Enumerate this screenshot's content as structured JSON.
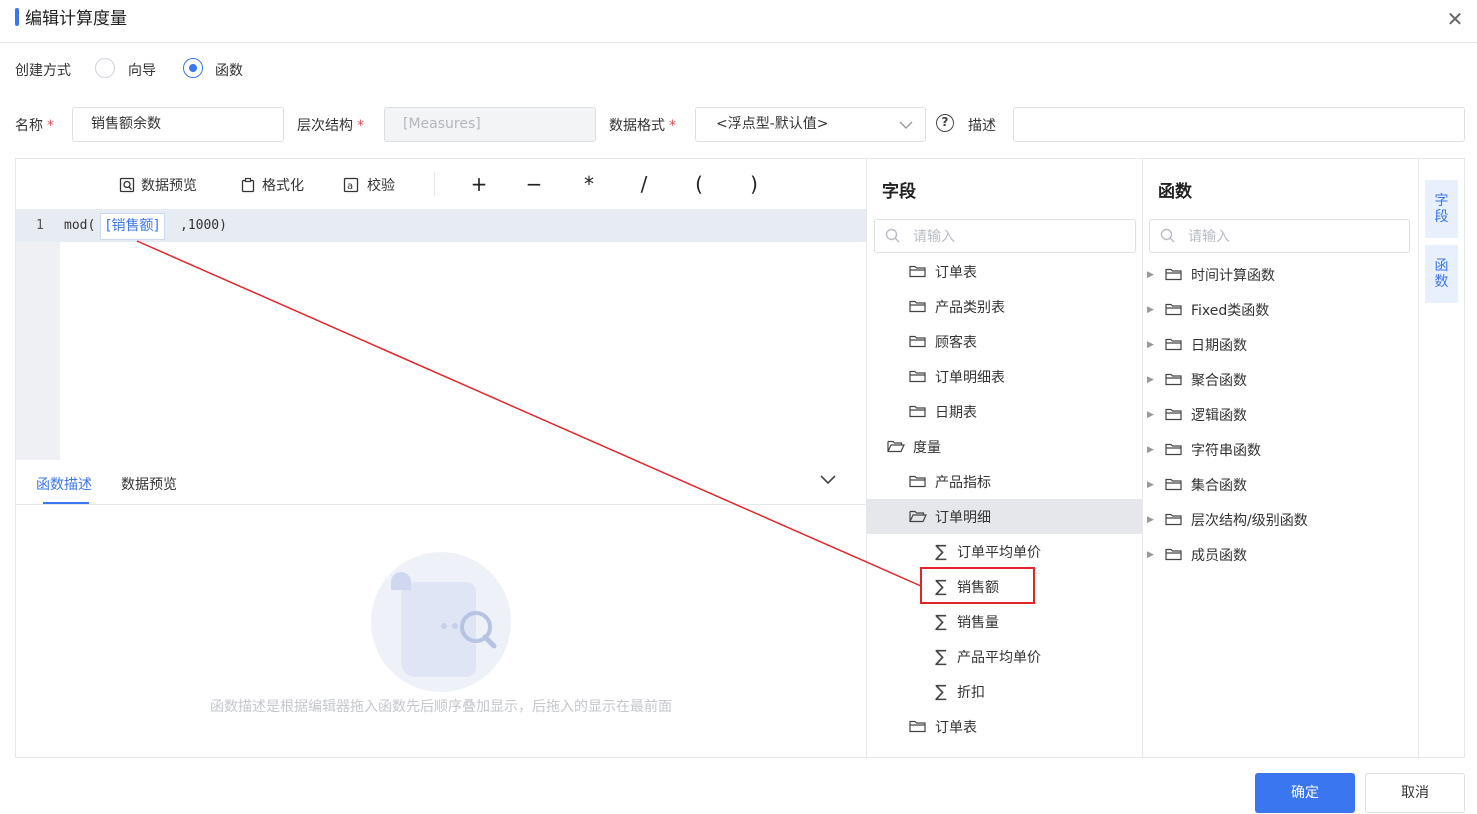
{
  "dialog": {
    "title": "编辑计算度量"
  },
  "create_mode": {
    "label": "创建方式",
    "options": [
      {
        "label": "向导",
        "checked": false
      },
      {
        "label": "函数",
        "checked": true
      }
    ]
  },
  "form": {
    "name_label": "名称",
    "name_value": "销售额余数",
    "hierarchy_label": "层次结构",
    "hierarchy_value": "[Measures]",
    "format_label": "数据格式",
    "format_value": "<浮点型-默认值>",
    "description_label": "描述",
    "description_value": "",
    "required_mark": "*"
  },
  "toolbar": {
    "preview": "数据预览",
    "format": "格式化",
    "validate": "校验",
    "ops": [
      "+",
      "−",
      "*",
      "/",
      "(",
      ")"
    ]
  },
  "editor": {
    "line_number": "1",
    "code_prefix": "mod(",
    "field": "[销售额]",
    "code_suffix": ",1000)"
  },
  "bottom_tabs": {
    "tabs": [
      "函数描述",
      "数据预览"
    ],
    "active": "函数描述",
    "empty_text": "函数描述是根据编辑器拖入函数先后顺序叠加显示，后拖入的显示在最前面"
  },
  "fields_panel": {
    "title": "字段",
    "search_placeholder": "请输入",
    "items": [
      {
        "label": "订单表",
        "type": "folder",
        "level": 1
      },
      {
        "label": "产品类别表",
        "type": "folder",
        "level": 1
      },
      {
        "label": "顾客表",
        "type": "folder",
        "level": 1
      },
      {
        "label": "订单明细表",
        "type": "folder",
        "level": 1
      },
      {
        "label": "日期表",
        "type": "folder",
        "level": 1
      },
      {
        "label": "度量",
        "type": "folder-open",
        "level": 0
      },
      {
        "label": "产品指标",
        "type": "folder",
        "level": 1
      },
      {
        "label": "订单明细",
        "type": "folder-open",
        "level": 1,
        "selected": true
      },
      {
        "label": "订单平均单价",
        "type": "measure",
        "level": 2
      },
      {
        "label": "销售额",
        "type": "measure",
        "level": 2,
        "highlighted": true
      },
      {
        "label": "销售量",
        "type": "measure",
        "level": 2
      },
      {
        "label": "产品平均单价",
        "type": "measure",
        "level": 2
      },
      {
        "label": "折扣",
        "type": "measure",
        "level": 2
      },
      {
        "label": "订单表",
        "type": "folder",
        "level": 1
      }
    ]
  },
  "functions_panel": {
    "title": "函数",
    "search_placeholder": "请输入",
    "items": [
      "时间计算函数",
      "Fixed类函数",
      "日期函数",
      "聚合函数",
      "逻辑函数",
      "字符串函数",
      "集合函数",
      "层次结构/级别函数",
      "成员函数"
    ]
  },
  "side_tabs": [
    "字段",
    "函数"
  ],
  "buttons": {
    "ok": "确定",
    "cancel": "取消"
  },
  "colors": {
    "accent": "#3a76f0",
    "highlight": "#e0262b"
  }
}
